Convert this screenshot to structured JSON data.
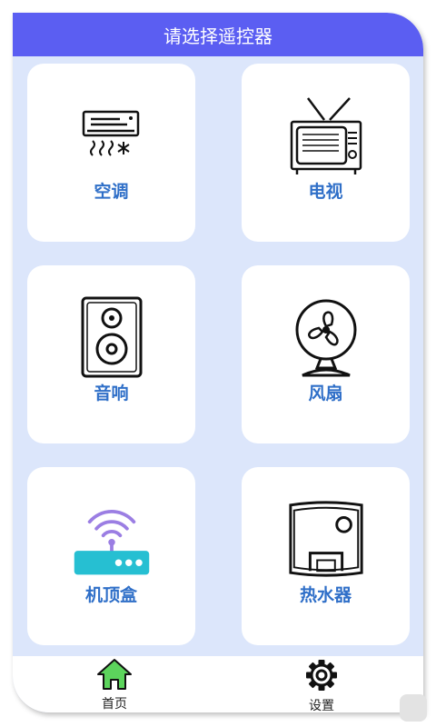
{
  "header": {
    "title": "请选择遥控器"
  },
  "devices": [
    {
      "label": "空调",
      "icon": "air-conditioner-icon"
    },
    {
      "label": "电视",
      "icon": "tv-icon"
    },
    {
      "label": "音响",
      "icon": "speaker-icon"
    },
    {
      "label": "风扇",
      "icon": "fan-icon"
    },
    {
      "label": "机顶盒",
      "icon": "router-icon"
    },
    {
      "label": "热水器",
      "icon": "water-heater-icon"
    }
  ],
  "tabbar": {
    "home_label": "首页",
    "settings_label": "设置"
  },
  "colors": {
    "header_bg": "#5b5ef2",
    "page_bg": "#dce6fb",
    "label_blue": "#2f6fc8",
    "home_green": "#5cd45c"
  }
}
